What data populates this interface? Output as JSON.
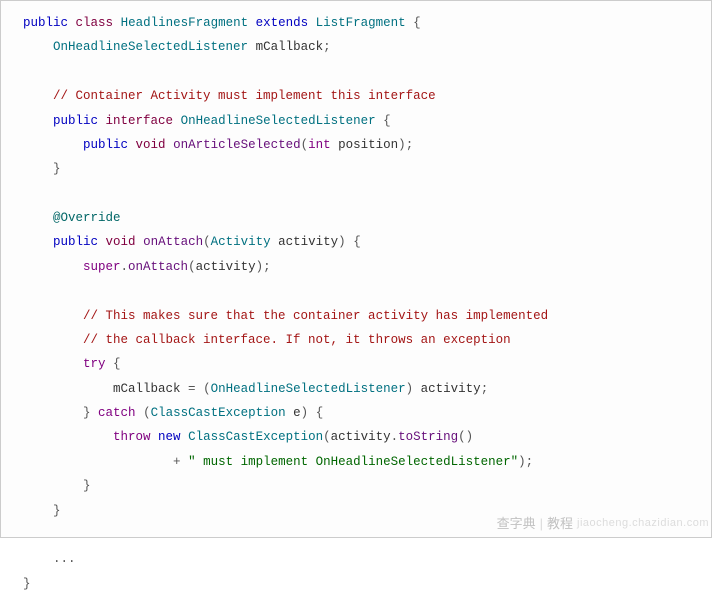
{
  "code": {
    "tokens": {
      "kw_public": "public",
      "kw_class": "class",
      "kw_extends": "extends",
      "kw_interface": "interface",
      "kw_void": "void",
      "kw_int": "int",
      "kw_super": "super",
      "kw_try": "try",
      "kw_catch": "catch",
      "kw_throw": "throw",
      "kw_new": "new",
      "annotation_override": "@Override",
      "type_HeadlinesFragment": "HeadlinesFragment",
      "type_ListFragment": "ListFragment",
      "type_OnHeadlineSelectedListener": "OnHeadlineSelectedListener",
      "type_Activity": "Activity",
      "type_ClassCastException": "ClassCastException",
      "method_onArticleSelected": "onArticleSelected",
      "method_onAttach": "onAttach",
      "method_toString": "toString",
      "var_mCallback": "mCallback",
      "var_position": "position",
      "var_activity": "activity",
      "var_e": "e",
      "comment_container": "// Container Activity must implement this interface",
      "comment_impl1": "// This makes sure that the container activity has implemented",
      "comment_impl2": "// the callback interface. If not, it throws an exception",
      "string_mustImpl": "\" must implement OnHeadlineSelectedListener\"",
      "ellipsis": "..."
    }
  },
  "watermark": {
    "brand": "查字典",
    "label": "教程",
    "url": "jiaocheng.chazidian.com"
  }
}
